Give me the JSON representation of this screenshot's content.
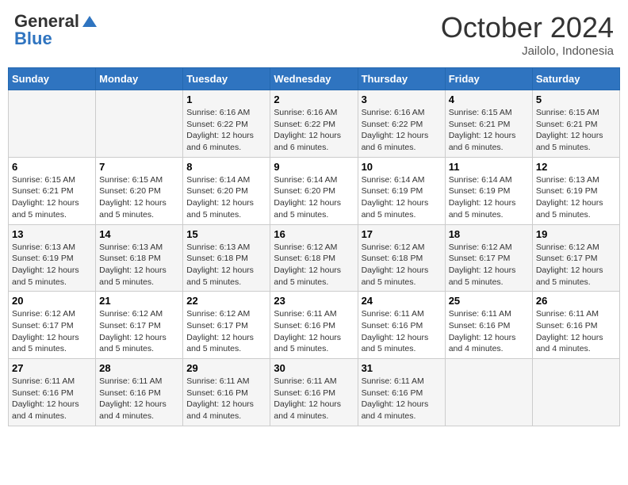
{
  "logo": {
    "line1": "General",
    "line2": "Blue"
  },
  "title": "October 2024",
  "location": "Jailolo, Indonesia",
  "days_of_week": [
    "Sunday",
    "Monday",
    "Tuesday",
    "Wednesday",
    "Thursday",
    "Friday",
    "Saturday"
  ],
  "weeks": [
    [
      {
        "day": "",
        "info": ""
      },
      {
        "day": "",
        "info": ""
      },
      {
        "day": "1",
        "info": "Sunrise: 6:16 AM\nSunset: 6:22 PM\nDaylight: 12 hours and 6 minutes."
      },
      {
        "day": "2",
        "info": "Sunrise: 6:16 AM\nSunset: 6:22 PM\nDaylight: 12 hours and 6 minutes."
      },
      {
        "day": "3",
        "info": "Sunrise: 6:16 AM\nSunset: 6:22 PM\nDaylight: 12 hours and 6 minutes."
      },
      {
        "day": "4",
        "info": "Sunrise: 6:15 AM\nSunset: 6:21 PM\nDaylight: 12 hours and 6 minutes."
      },
      {
        "day": "5",
        "info": "Sunrise: 6:15 AM\nSunset: 6:21 PM\nDaylight: 12 hours and 5 minutes."
      }
    ],
    [
      {
        "day": "6",
        "info": "Sunrise: 6:15 AM\nSunset: 6:21 PM\nDaylight: 12 hours and 5 minutes."
      },
      {
        "day": "7",
        "info": "Sunrise: 6:15 AM\nSunset: 6:20 PM\nDaylight: 12 hours and 5 minutes."
      },
      {
        "day": "8",
        "info": "Sunrise: 6:14 AM\nSunset: 6:20 PM\nDaylight: 12 hours and 5 minutes."
      },
      {
        "day": "9",
        "info": "Sunrise: 6:14 AM\nSunset: 6:20 PM\nDaylight: 12 hours and 5 minutes."
      },
      {
        "day": "10",
        "info": "Sunrise: 6:14 AM\nSunset: 6:19 PM\nDaylight: 12 hours and 5 minutes."
      },
      {
        "day": "11",
        "info": "Sunrise: 6:14 AM\nSunset: 6:19 PM\nDaylight: 12 hours and 5 minutes."
      },
      {
        "day": "12",
        "info": "Sunrise: 6:13 AM\nSunset: 6:19 PM\nDaylight: 12 hours and 5 minutes."
      }
    ],
    [
      {
        "day": "13",
        "info": "Sunrise: 6:13 AM\nSunset: 6:19 PM\nDaylight: 12 hours and 5 minutes."
      },
      {
        "day": "14",
        "info": "Sunrise: 6:13 AM\nSunset: 6:18 PM\nDaylight: 12 hours and 5 minutes."
      },
      {
        "day": "15",
        "info": "Sunrise: 6:13 AM\nSunset: 6:18 PM\nDaylight: 12 hours and 5 minutes."
      },
      {
        "day": "16",
        "info": "Sunrise: 6:12 AM\nSunset: 6:18 PM\nDaylight: 12 hours and 5 minutes."
      },
      {
        "day": "17",
        "info": "Sunrise: 6:12 AM\nSunset: 6:18 PM\nDaylight: 12 hours and 5 minutes."
      },
      {
        "day": "18",
        "info": "Sunrise: 6:12 AM\nSunset: 6:17 PM\nDaylight: 12 hours and 5 minutes."
      },
      {
        "day": "19",
        "info": "Sunrise: 6:12 AM\nSunset: 6:17 PM\nDaylight: 12 hours and 5 minutes."
      }
    ],
    [
      {
        "day": "20",
        "info": "Sunrise: 6:12 AM\nSunset: 6:17 PM\nDaylight: 12 hours and 5 minutes."
      },
      {
        "day": "21",
        "info": "Sunrise: 6:12 AM\nSunset: 6:17 PM\nDaylight: 12 hours and 5 minutes."
      },
      {
        "day": "22",
        "info": "Sunrise: 6:12 AM\nSunset: 6:17 PM\nDaylight: 12 hours and 5 minutes."
      },
      {
        "day": "23",
        "info": "Sunrise: 6:11 AM\nSunset: 6:16 PM\nDaylight: 12 hours and 5 minutes."
      },
      {
        "day": "24",
        "info": "Sunrise: 6:11 AM\nSunset: 6:16 PM\nDaylight: 12 hours and 5 minutes."
      },
      {
        "day": "25",
        "info": "Sunrise: 6:11 AM\nSunset: 6:16 PM\nDaylight: 12 hours and 4 minutes."
      },
      {
        "day": "26",
        "info": "Sunrise: 6:11 AM\nSunset: 6:16 PM\nDaylight: 12 hours and 4 minutes."
      }
    ],
    [
      {
        "day": "27",
        "info": "Sunrise: 6:11 AM\nSunset: 6:16 PM\nDaylight: 12 hours and 4 minutes."
      },
      {
        "day": "28",
        "info": "Sunrise: 6:11 AM\nSunset: 6:16 PM\nDaylight: 12 hours and 4 minutes."
      },
      {
        "day": "29",
        "info": "Sunrise: 6:11 AM\nSunset: 6:16 PM\nDaylight: 12 hours and 4 minutes."
      },
      {
        "day": "30",
        "info": "Sunrise: 6:11 AM\nSunset: 6:16 PM\nDaylight: 12 hours and 4 minutes."
      },
      {
        "day": "31",
        "info": "Sunrise: 6:11 AM\nSunset: 6:16 PM\nDaylight: 12 hours and 4 minutes."
      },
      {
        "day": "",
        "info": ""
      },
      {
        "day": "",
        "info": ""
      }
    ]
  ]
}
